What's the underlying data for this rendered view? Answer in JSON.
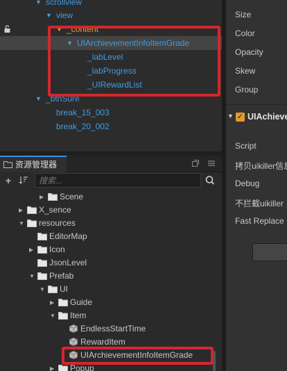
{
  "hierarchy": {
    "nodes": [
      {
        "label": "scrollview",
        "arrow": "▼",
        "color": "blue"
      },
      {
        "label": "view",
        "arrow": "▼",
        "color": "blue"
      },
      {
        "label": "_content",
        "arrow": "▼",
        "color": "orange"
      },
      {
        "label": "UIArchievementInfoItemGrade",
        "arrow": "▼",
        "color": "blue"
      },
      {
        "label": "_labLevel",
        "color": "blue"
      },
      {
        "label": "_labProgress",
        "color": "blue"
      },
      {
        "label": "_UIRewardList",
        "color": "blue"
      },
      {
        "label": "_btnSure",
        "arrow": "▼",
        "color": "blue"
      },
      {
        "label": "break_15_003",
        "color": "blue"
      },
      {
        "label": "break_20_002",
        "color": "blue"
      }
    ]
  },
  "asset_panel": {
    "tab_label": "资源管理器",
    "search_placeholder": "搜索...",
    "tree": [
      {
        "label": "Scene",
        "arrow": "▶",
        "icon": "folder-icon"
      },
      {
        "label": "X_sence",
        "arrow": "▶",
        "icon": "folder-icon"
      },
      {
        "label": "resources",
        "arrow": "▼",
        "icon": "folder-icon"
      },
      {
        "label": "EditorMap",
        "icon": "folder-icon"
      },
      {
        "label": "Icon",
        "arrow": "▶",
        "icon": "folder-icon"
      },
      {
        "label": "JsonLevel",
        "icon": "folder-icon"
      },
      {
        "label": "Prefab",
        "arrow": "▼",
        "icon": "folder-icon"
      },
      {
        "label": "UI",
        "arrow": "▼",
        "icon": "folder-icon"
      },
      {
        "label": "Guide",
        "arrow": "▶",
        "icon": "folder-icon"
      },
      {
        "label": "Item",
        "arrow": "▼",
        "icon": "folder-icon"
      },
      {
        "label": "EndlessStartTime",
        "icon": "prefab-icon"
      },
      {
        "label": "RewardItem",
        "icon": "prefab-icon"
      },
      {
        "label": "UIArchievementInfoItemGrade",
        "icon": "prefab-icon"
      },
      {
        "label": "Popup",
        "arrow": "▶",
        "icon": "folder-icon"
      }
    ]
  },
  "inspector": {
    "node_props": [
      "Size",
      "Color",
      "Opacity",
      "Skew",
      "Group"
    ],
    "component_title": "UIAchievementInfoItemGrade",
    "component_props": [
      "Script",
      "拷贝uikiller信息",
      "Debug",
      "不拦截uikiller",
      "Fast Replace"
    ]
  },
  "colors": {
    "highlight": "#d6262e",
    "node_blue": "#3c9ee4",
    "node_orange": "#e6a23c",
    "accent": "#3a8ee6"
  }
}
